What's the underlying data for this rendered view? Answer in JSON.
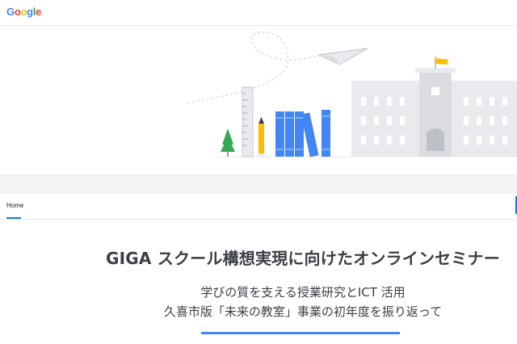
{
  "header": {
    "logo_letters": [
      {
        "char": "G",
        "color": "#4285f4"
      },
      {
        "char": "o",
        "color": "#ea4335"
      },
      {
        "char": "o",
        "color": "#fbbc05"
      },
      {
        "char": "g",
        "color": "#4285f4"
      },
      {
        "char": "l",
        "color": "#34a853"
      },
      {
        "char": "e",
        "color": "#ea4335"
      }
    ]
  },
  "hero": {
    "illustration": [
      "paper-plane-icon",
      "ruler-icon",
      "pencil-icon",
      "tree-icon",
      "books-icon",
      "school-building-icon",
      "flag-icon"
    ],
    "colors": {
      "blue": "#4285f4",
      "yellow": "#fbbc05",
      "green": "#34a853",
      "building": "#e8eaed"
    }
  },
  "nav": {
    "home_label": "Home",
    "active_color": "#1a73e8"
  },
  "main": {
    "title": "GIGA スクール構想実現に向けたオンラインセミナー",
    "subtitle_line1": "学びの質を支える授業研究とICT 活用",
    "subtitle_line2": "久喜市版「未来の教室」事業の初年度を振り返って"
  }
}
